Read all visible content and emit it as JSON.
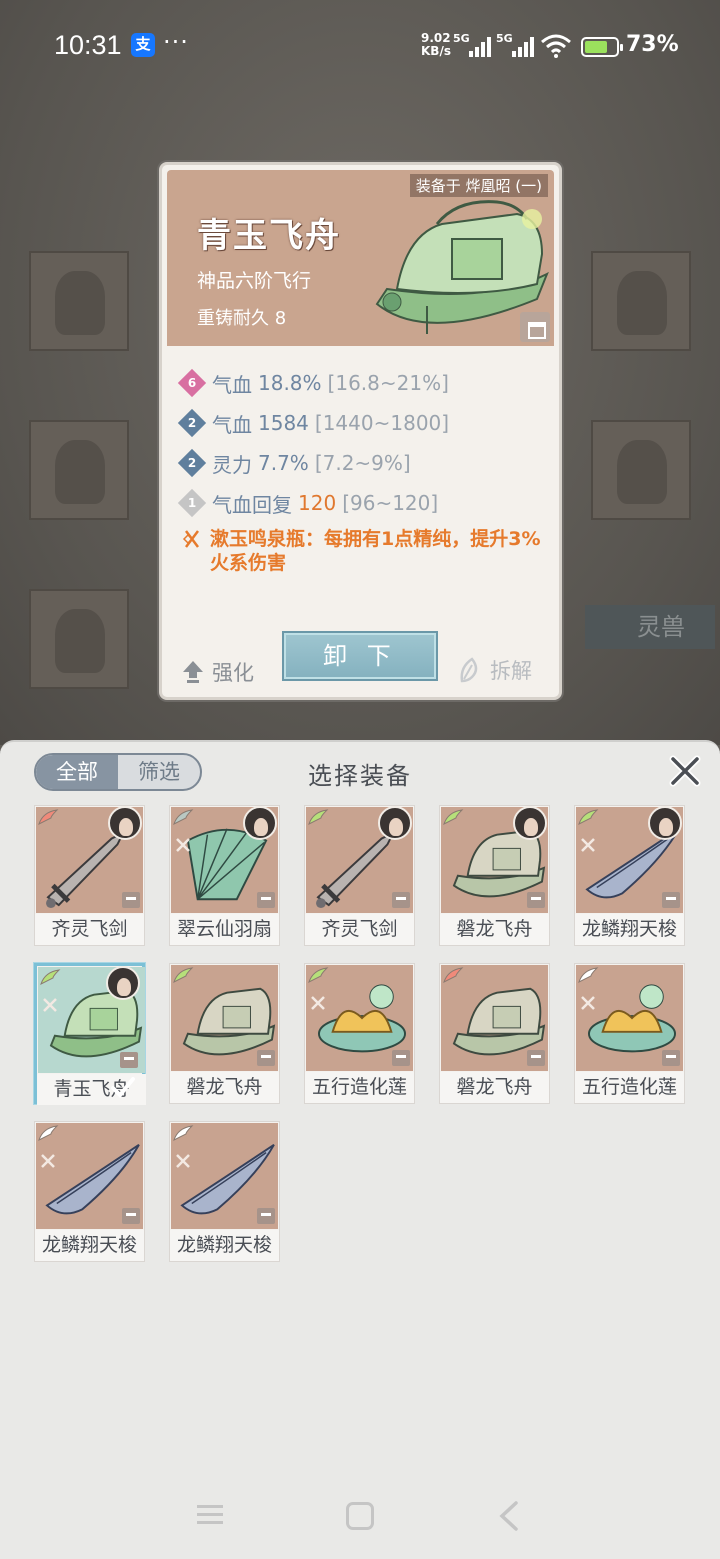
{
  "status_bar": {
    "time": "10:31",
    "alipay_glyph": "支",
    "more": "···",
    "net_speed_value": "9.02",
    "net_speed_unit": "KB/s",
    "sim1": "5G",
    "sim2": "5G",
    "battery": "73%"
  },
  "background": {
    "spirit_beast_tab": "灵兽"
  },
  "detail": {
    "equipped_by": "装备于 烨凰昭 (一)",
    "name": "青玉飞舟",
    "grade": "神品六阶飞行",
    "durability": "重铸耐久 8",
    "stats": [
      {
        "level": "6",
        "level_color": "#d86fa1",
        "name": "气血",
        "value": "18.8%",
        "range": "[16.8~21%]"
      },
      {
        "level": "2",
        "level_color": "#5f7f9d",
        "name": "气血",
        "value": "1584",
        "range": "[1440~1800]"
      },
      {
        "level": "2",
        "level_color": "#5f7f9d",
        "name": "灵力",
        "value": "7.7%",
        "range": "[7.2~9%]"
      },
      {
        "level": "1",
        "level_color": "#c5c5c5",
        "name": "气血回复",
        "value": "120",
        "range": "[96~120]"
      }
    ],
    "special_effect": "漱玉鸣泉瓶：每拥有1点精纯，提升3%火系伤害",
    "enhance_label": "强化",
    "unequip_label": "卸 下",
    "dismantle_label": "拆解"
  },
  "sheet": {
    "title": "选择装备",
    "filter_all": "全部",
    "filter_screen": "筛选",
    "items": [
      {
        "name": "齐灵飞剑",
        "wing_color": "#f08a7a",
        "art": "sword",
        "avatar": true,
        "set_icon": false
      },
      {
        "name": "翠云仙羽扇",
        "wing_color": "#b9c8c2",
        "art": "fan",
        "avatar": true,
        "set_icon": true
      },
      {
        "name": "齐灵飞剑",
        "wing_color": "#b6e07a",
        "art": "sword",
        "avatar": true,
        "set_icon": false
      },
      {
        "name": "磐龙飞舟",
        "wing_color": "#b6e07a",
        "art": "boat",
        "avatar": true,
        "set_icon": false
      },
      {
        "name": "龙鳞翔天梭",
        "wing_color": "#b6e07a",
        "art": "shuttle",
        "avatar": true,
        "set_icon": true
      },
      {
        "name": "青玉飞舟",
        "wing_color": "#b6e07a",
        "art": "boat-green",
        "avatar": true,
        "set_icon": true,
        "selected": true
      },
      {
        "name": "磐龙飞舟",
        "wing_color": "#b6e07a",
        "art": "boat",
        "avatar": false,
        "set_icon": false
      },
      {
        "name": "五行造化莲",
        "wing_color": "#b6e07a",
        "art": "lotus",
        "avatar": false,
        "set_icon": true
      },
      {
        "name": "磐龙飞舟",
        "wing_color": "#f08a7a",
        "art": "boat",
        "avatar": false,
        "set_icon": false
      },
      {
        "name": "五行造化莲",
        "wing_color": "#ffffff",
        "art": "lotus",
        "avatar": false,
        "set_icon": true
      },
      {
        "name": "龙鳞翔天梭",
        "wing_color": "#ffffff",
        "art": "shuttle",
        "avatar": false,
        "set_icon": true
      },
      {
        "name": "龙鳞翔天梭",
        "wing_color": "#ffffff",
        "art": "shuttle",
        "avatar": false,
        "set_icon": true
      }
    ]
  }
}
